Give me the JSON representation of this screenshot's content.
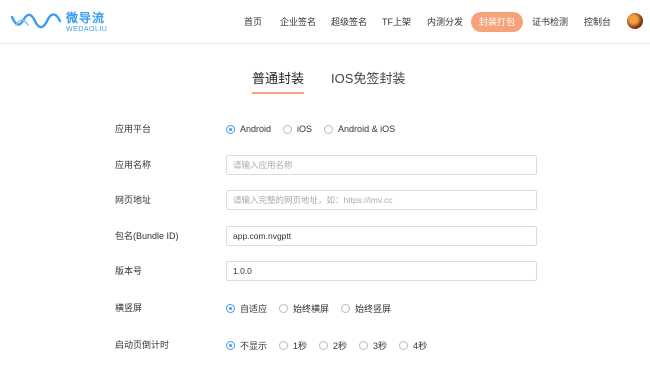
{
  "brand": {
    "name_cn": "微导流",
    "name_en": "WEDAOLIU",
    "color": "#3b9cf0"
  },
  "nav": [
    {
      "label": "首页"
    },
    {
      "label": "企业签名"
    },
    {
      "label": "超级签名"
    },
    {
      "label": "TF上架"
    },
    {
      "label": "内测分发"
    },
    {
      "label": "封装打包",
      "active": true
    },
    {
      "label": "证书检测"
    },
    {
      "label": "控制台"
    }
  ],
  "accent_color": "#f6a27a",
  "tabs": [
    {
      "label": "普通封装",
      "active": true
    },
    {
      "label": "IOS免签封装"
    }
  ],
  "form": {
    "platform": {
      "label": "应用平台",
      "options": [
        "Android",
        "iOS",
        "Android & iOS"
      ],
      "selected": "Android"
    },
    "app_name": {
      "label": "应用名称",
      "value": "",
      "placeholder": "请输入应用名称"
    },
    "url": {
      "label": "网页地址",
      "value": "",
      "placeholder": "请输入完整的网页地址，如：https://imv.cc"
    },
    "bundle_id": {
      "label": "包名(Bundle ID)",
      "value": "app.com.nvgptt"
    },
    "version": {
      "label": "版本号",
      "value": "1.0.0"
    },
    "orientation": {
      "label": "横竖屏",
      "options": [
        "自适应",
        "始终横屏",
        "始终竖屏"
      ],
      "selected": "自适应"
    },
    "splash_countdown": {
      "label": "启动页倒计时",
      "options": [
        "不显示",
        "1秒",
        "2秒",
        "3秒",
        "4秒"
      ],
      "selected": "不显示"
    }
  }
}
